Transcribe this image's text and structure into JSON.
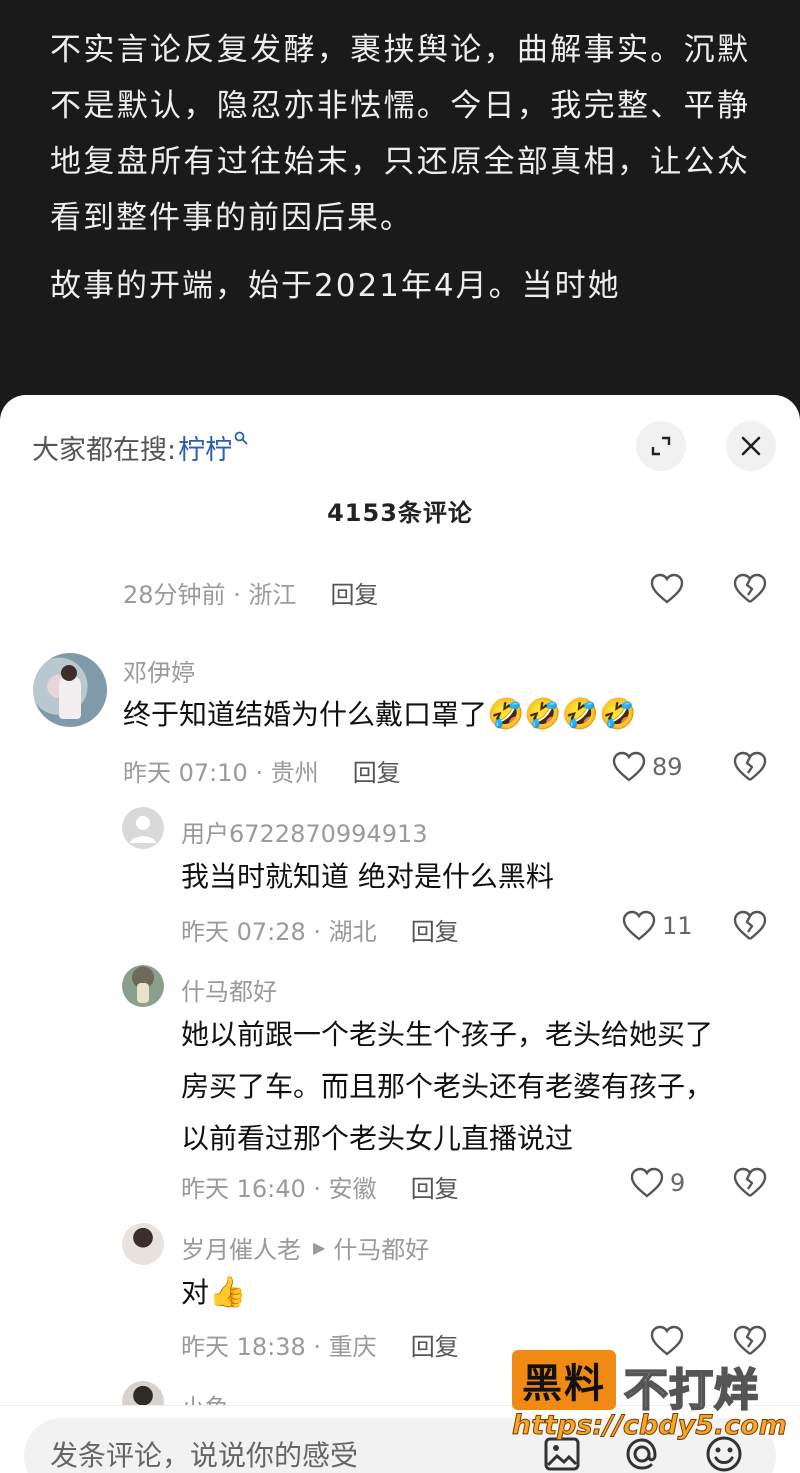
{
  "article": {
    "paragraph1": "不实言论反复发酵，裹挟舆论，曲解事实。沉默不是默认，隐忍亦非怯懦。今日，我完整、平静地复盘所有过往始末，只还原全部真相，让公众看到整件事的前因后果。",
    "paragraph2": "故事的开端，始于2021年4月。当时她"
  },
  "sheet": {
    "search_label": "大家都在搜:",
    "search_keyword": "柠柠",
    "comment_count": "4153条评论"
  },
  "comments": [
    {
      "meta": "28分钟前 · 浙江",
      "reply": "回复",
      "likes": ""
    },
    {
      "user": "邓伊婷",
      "text": "终于知道结婚为什么戴口罩了",
      "emoji": "🤣🤣🤣🤣",
      "meta": "昨天 07:10 · 贵州",
      "reply": "回复",
      "likes": "89"
    },
    {
      "user": "用户6722870994913",
      "text": "我当时就知道  绝对是什么黑料",
      "meta": "昨天 07:28 · 湖北",
      "reply": "回复",
      "likes": "11"
    },
    {
      "user": "什马都好",
      "text_lines": [
        "她以前跟一个老头生个孩子，老头给她买了",
        "房买了车。而且那个老头还有老婆有孩子，",
        "以前看过那个老头女儿直播说过"
      ],
      "meta": "昨天 16:40 · 安徽",
      "reply": "回复",
      "likes": "9"
    },
    {
      "user": "岁月催人老",
      "reply_to": "什马都好",
      "text": "对",
      "emoji": "👍",
      "meta": "昨天 18:38 · 重庆",
      "reply": "回复",
      "likes": ""
    },
    {
      "user": "小鱼"
    }
  ],
  "input": {
    "placeholder": "发条评论，说说你的感受"
  },
  "watermark": {
    "box_text": "黑料",
    "tail_text": "不打烊",
    "url": "https://cbdy5.com"
  },
  "colors": {
    "accent": "#2a5db0",
    "article_bg": "#1a1a1a",
    "watermark_orange": "#f08a14"
  }
}
